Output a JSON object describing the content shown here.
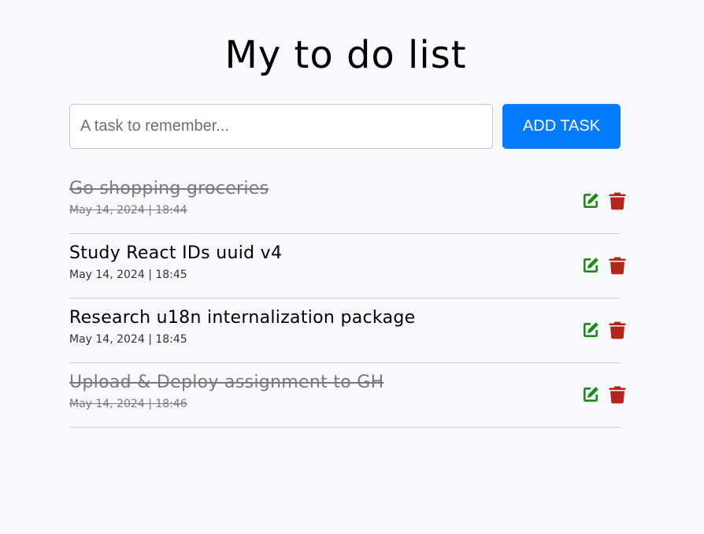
{
  "title": "My to do list",
  "form": {
    "placeholder": "A task to remember...",
    "value": "",
    "add_label": "ADD TASK"
  },
  "colors": {
    "accent": "#037bff",
    "edit_icon": "#1a8c1a",
    "delete_icon": "#b3261e"
  },
  "icons": {
    "edit": "edit-icon",
    "delete": "trash-icon"
  },
  "tasks": [
    {
      "text": "Go shopping groceries",
      "date": "May 14, 2024 | 18:44",
      "done": true
    },
    {
      "text": "Study React IDs uuid v4",
      "date": "May 14, 2024 | 18:45",
      "done": false
    },
    {
      "text": "Research u18n internalization package",
      "date": "May 14, 2024 | 18:45",
      "done": false
    },
    {
      "text": "Upload & Deploy assignment to GH",
      "date": "May 14, 2024 | 18:46",
      "done": true
    }
  ]
}
